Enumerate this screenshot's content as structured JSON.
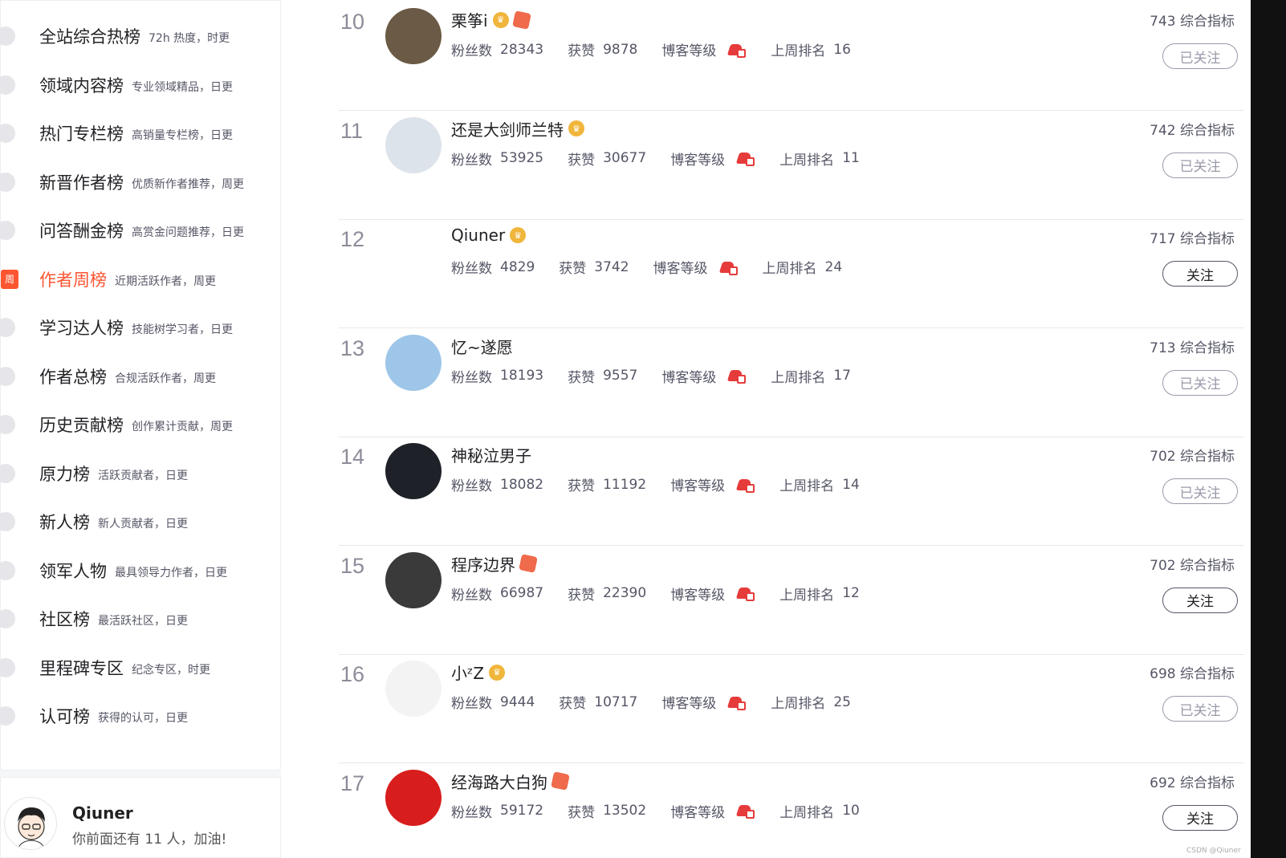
{
  "sidebar": {
    "items": [
      {
        "label": "全站综合热榜",
        "desc": "72h 热度，时更",
        "icon": "rocket-icon",
        "active": false
      },
      {
        "label": "领域内容榜",
        "desc": "专业领域精品，日更",
        "icon": "code-icon",
        "active": false
      },
      {
        "label": "热门专栏榜",
        "desc": "高销量专栏榜，日更",
        "icon": "column-icon",
        "active": false
      },
      {
        "label": "新晋作者榜",
        "desc": "优质新作者推荐，周更",
        "icon": "user-icon",
        "active": false
      },
      {
        "label": "问答酬金榜",
        "desc": "高赏金问题推荐，日更",
        "icon": "question-icon",
        "active": false
      },
      {
        "label": "作者周榜",
        "desc": "近期活跃作者，周更",
        "icon": "week-icon",
        "icon_text": "周",
        "active": true
      },
      {
        "label": "学习达人榜",
        "desc": "技能树学习者，日更",
        "icon": "medal-icon",
        "active": false
      },
      {
        "label": "作者总榜",
        "desc": "合规活跃作者，周更",
        "icon": "group-icon",
        "active": false
      },
      {
        "label": "历史贡献榜",
        "desc": "创作累计贡献，周更",
        "icon": "contribution-icon",
        "active": false
      },
      {
        "label": "原力榜",
        "desc": "活跃贡献者，日更",
        "icon": "force-icon",
        "active": false
      },
      {
        "label": "新人榜",
        "desc": "新人贡献者，日更",
        "icon": "newbie-icon",
        "active": false
      },
      {
        "label": "领军人物",
        "desc": "最具领导力作者，日更",
        "icon": "leader-icon",
        "active": false
      },
      {
        "label": "社区榜",
        "desc": "最活跃社区，日更",
        "icon": "community-icon",
        "active": false
      },
      {
        "label": "里程碑专区",
        "desc": "纪念专区，时更",
        "icon": "milestone-icon",
        "active": false
      },
      {
        "label": "认可榜",
        "desc": "获得的认可，日更",
        "icon": "approval-icon",
        "active": false
      }
    ]
  },
  "self": {
    "name": "Qiuner",
    "hint": "你前面还有 11 人，加油!"
  },
  "labels": {
    "fans": "粉丝数",
    "likes": "获赞",
    "level": "博客等级",
    "last_week": "上周排名",
    "score_suffix": "综合指标"
  },
  "rows": [
    {
      "rank": "10",
      "name": "栗筝i",
      "badges": [
        "crown",
        "cube"
      ],
      "fans": "28343",
      "likes": "9878",
      "last_week": "16",
      "score": "743",
      "follow": "已关注",
      "followed": true,
      "avatar_color": "#6b5a45"
    },
    {
      "rank": "11",
      "name": "还是大剑师兰特",
      "badges": [
        "crown"
      ],
      "fans": "53925",
      "likes": "30677",
      "last_week": "11",
      "score": "742",
      "follow": "已关注",
      "followed": true,
      "avatar_color": "#dde3ea"
    },
    {
      "rank": "12",
      "name": "Qiuner",
      "badges": [
        "crown"
      ],
      "fans": "4829",
      "likes": "3742",
      "last_week": "24",
      "score": "717",
      "follow": "关注",
      "followed": false,
      "avatar_color": "#ffffff"
    },
    {
      "rank": "13",
      "name": "忆~遂愿",
      "badges": [],
      "fans": "18193",
      "likes": "9557",
      "last_week": "17",
      "score": "713",
      "follow": "已关注",
      "followed": true,
      "avatar_color": "#9ec6e8"
    },
    {
      "rank": "14",
      "name": "神秘泣男子",
      "badges": [],
      "fans": "18082",
      "likes": "11192",
      "last_week": "14",
      "score": "702",
      "follow": "已关注",
      "followed": true,
      "avatar_color": "#1e2228"
    },
    {
      "rank": "15",
      "name": "程序边界",
      "badges": [
        "cube"
      ],
      "fans": "66987",
      "likes": "22390",
      "last_week": "12",
      "score": "702",
      "follow": "关注",
      "followed": false,
      "avatar_color": "#3a3a3a"
    },
    {
      "rank": "16",
      "name": "小ᶻZ",
      "badges": [
        "crown"
      ],
      "fans": "9444",
      "likes": "10717",
      "last_week": "25",
      "score": "698",
      "follow": "已关注",
      "followed": true,
      "avatar_color": "#f3f3f3"
    },
    {
      "rank": "17",
      "name": "经海路大白狗",
      "badges": [
        "cube"
      ],
      "fans": "59172",
      "likes": "13502",
      "last_week": "10",
      "score": "692",
      "follow": "关注",
      "followed": false,
      "avatar_color": "#d81d1d"
    }
  ],
  "watermark": "CSDN @Qiuner",
  "colors": {
    "accent": "#fc5531",
    "level_red": "#e63b3b",
    "crown_gold": "#f0b53b"
  }
}
